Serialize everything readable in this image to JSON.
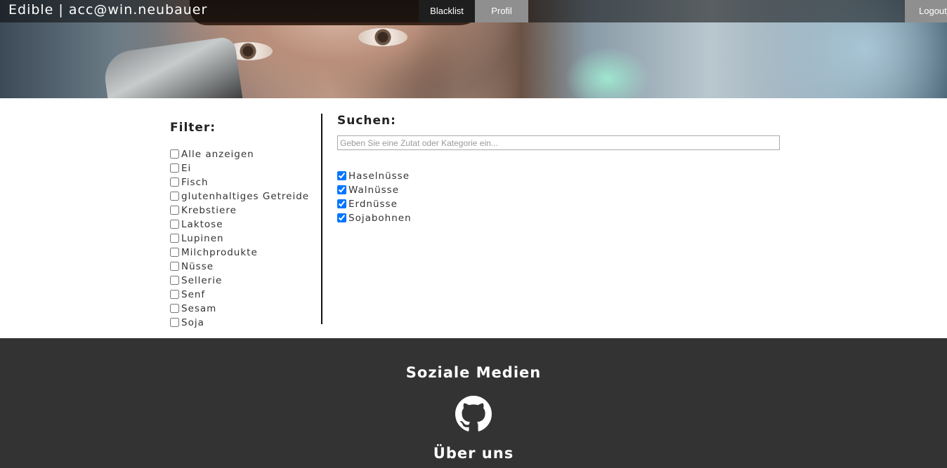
{
  "header": {
    "brand": "Edible | acc@win.neubauer",
    "nav": {
      "blacklist": "Blacklist",
      "profil": "Profil",
      "logout": "Logout"
    }
  },
  "filter": {
    "title": "Filter:",
    "items": [
      {
        "label": "Alle anzeigen",
        "checked": false
      },
      {
        "label": "Ei",
        "checked": false
      },
      {
        "label": "Fisch",
        "checked": false
      },
      {
        "label": "glutenhaltiges Getreide",
        "checked": false
      },
      {
        "label": "Krebstiere",
        "checked": false
      },
      {
        "label": "Laktose",
        "checked": false
      },
      {
        "label": "Lupinen",
        "checked": false
      },
      {
        "label": "Milchprodukte",
        "checked": false
      },
      {
        "label": "Nüsse",
        "checked": false
      },
      {
        "label": "Sellerie",
        "checked": false
      },
      {
        "label": "Senf",
        "checked": false
      },
      {
        "label": "Sesam",
        "checked": false
      },
      {
        "label": "Soja",
        "checked": false
      }
    ]
  },
  "search": {
    "title": "Suchen:",
    "placeholder": "Geben Sie eine Zutat oder Kategorie ein...",
    "value": "",
    "selected": [
      {
        "label": "Haselnüsse",
        "checked": true
      },
      {
        "label": "Walnüsse",
        "checked": true
      },
      {
        "label": "Erdnüsse",
        "checked": true
      },
      {
        "label": "Sojabohnen",
        "checked": true
      }
    ]
  },
  "footer": {
    "social_title": "Soziale Medien",
    "social_icon": "github-icon",
    "about_title": "Über uns"
  },
  "colors": {
    "topbar": "#1e1e1e",
    "tab_inactive": "#8f8f8f",
    "footer_bg": "#333333"
  }
}
